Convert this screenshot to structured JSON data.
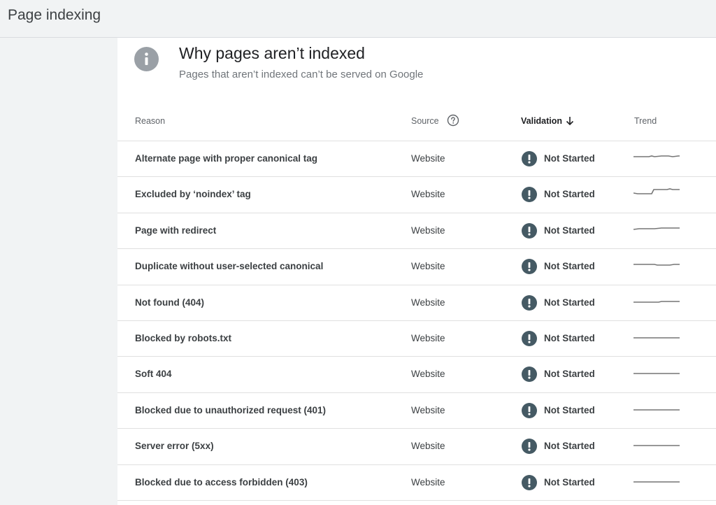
{
  "page": {
    "title": "Page indexing"
  },
  "card": {
    "title": "Why pages aren’t indexed",
    "subtitle": "Pages that aren’t indexed can’t be served on Google",
    "icon": "info-icon"
  },
  "table": {
    "headers": {
      "reason": "Reason",
      "source": "Source",
      "validation": "Validation",
      "trend": "Trend"
    },
    "rows": [
      {
        "reason": "Alternate page with proper canonical tag",
        "source": "Website",
        "validation": "Not Started",
        "trend_shape": "flat-bump"
      },
      {
        "reason": "Excluded by ‘noindex’ tag",
        "source": "Website",
        "validation": "Not Started",
        "trend_shape": "step-up"
      },
      {
        "reason": "Page with redirect",
        "source": "Website",
        "validation": "Not Started",
        "trend_shape": "slight-rise"
      },
      {
        "reason": "Duplicate without user-selected canonical",
        "source": "Website",
        "validation": "Not Started",
        "trend_shape": "slight-dip"
      },
      {
        "reason": "Not found (404)",
        "source": "Website",
        "validation": "Not Started",
        "trend_shape": "late-rise"
      },
      {
        "reason": "Blocked by robots.txt",
        "source": "Website",
        "validation": "Not Started",
        "trend_shape": "flat"
      },
      {
        "reason": "Soft 404",
        "source": "Website",
        "validation": "Not Started",
        "trend_shape": "flat"
      },
      {
        "reason": "Blocked due to unauthorized request (401)",
        "source": "Website",
        "validation": "Not Started",
        "trend_shape": "flat"
      },
      {
        "reason": "Server error (5xx)",
        "source": "Website",
        "validation": "Not Started",
        "trend_shape": "flat"
      },
      {
        "reason": "Blocked due to access forbidden (403)",
        "source": "Website",
        "validation": "Not Started",
        "trend_shape": "flat"
      }
    ]
  },
  "colors": {
    "status_icon": "#455a64",
    "trend_line": "#757575"
  }
}
